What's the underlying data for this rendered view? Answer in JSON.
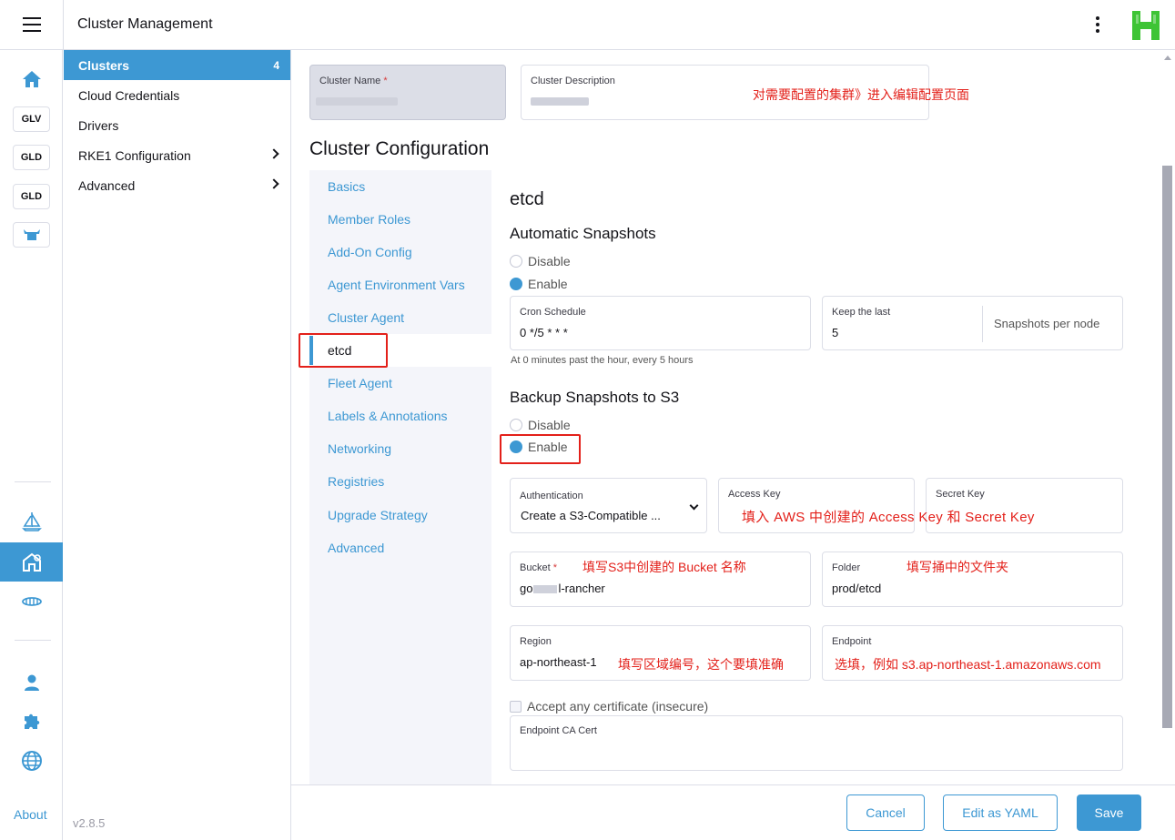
{
  "header": {
    "title": "Cluster Management"
  },
  "rail": {
    "chips": [
      "GLV",
      "GLD",
      "GLD"
    ],
    "about": "About"
  },
  "subnav": {
    "items": [
      {
        "label": "Clusters",
        "count": "4"
      },
      {
        "label": "Cloud Credentials"
      },
      {
        "label": "Drivers"
      },
      {
        "label": "RKE1 Configuration"
      },
      {
        "label": "Advanced"
      }
    ],
    "version": "v2.8.5"
  },
  "form": {
    "cluster_name_label": "Cluster Name",
    "required_mark": "*",
    "cluster_description_label": "Cluster Description",
    "annotation_edit": "对需要配置的集群》进入编辑配置页面"
  },
  "config": {
    "title": "Cluster Configuration",
    "tabs": [
      "Basics",
      "Member Roles",
      "Add-On Config",
      "Agent Environment Vars",
      "Cluster Agent",
      "etcd",
      "Fleet Agent",
      "Labels & Annotations",
      "Networking",
      "Registries",
      "Upgrade Strategy",
      "Advanced"
    ],
    "active_tab": "etcd"
  },
  "etcd": {
    "heading": "etcd",
    "auto_snapshots": {
      "heading": "Automatic Snapshots",
      "disable": "Disable",
      "enable": "Enable",
      "selected": "Enable",
      "cron_label": "Cron Schedule",
      "cron_value": "0 */5 * * *",
      "keep_label": "Keep the last",
      "keep_value": "5",
      "keep_suffix": "Snapshots per node",
      "hint": "At 0 minutes past the hour, every 5 hours"
    },
    "s3": {
      "heading": "Backup Snapshots to S3",
      "disable": "Disable",
      "enable": "Enable",
      "selected": "Enable",
      "auth_label": "Authentication",
      "auth_value": "Create a S3-Compatible ...",
      "access_key_label": "Access Key",
      "secret_key_label": "Secret Key",
      "annotation_keys": "填入 AWS 中创建的 Access Key 和 Secret Key",
      "bucket_label": "Bucket",
      "bucket_value_prefix": "go",
      "bucket_value_suffix": "l-rancher",
      "annotation_bucket": "填写S3中创建的 Bucket 名称",
      "folder_label": "Folder",
      "folder_value": "prod/etcd",
      "annotation_folder": "填写捅中的文件夹",
      "region_label": "Region",
      "region_value": "ap-northeast-1",
      "annotation_region": "填写区域编号，这个要填准确",
      "endpoint_label": "Endpoint",
      "annotation_endpoint": "选填，例如 s3.ap-northeast-1.amazonaws.com",
      "insecure_label": "Accept any certificate (insecure)",
      "ca_cert_label": "Endpoint CA Cert"
    }
  },
  "footer": {
    "cancel": "Cancel",
    "edit_yaml": "Edit as YAML",
    "save": "Save"
  },
  "colors": {
    "accent": "#3d98d3",
    "annotation_red": "#e3201a",
    "logo_green": "#3ec435"
  }
}
